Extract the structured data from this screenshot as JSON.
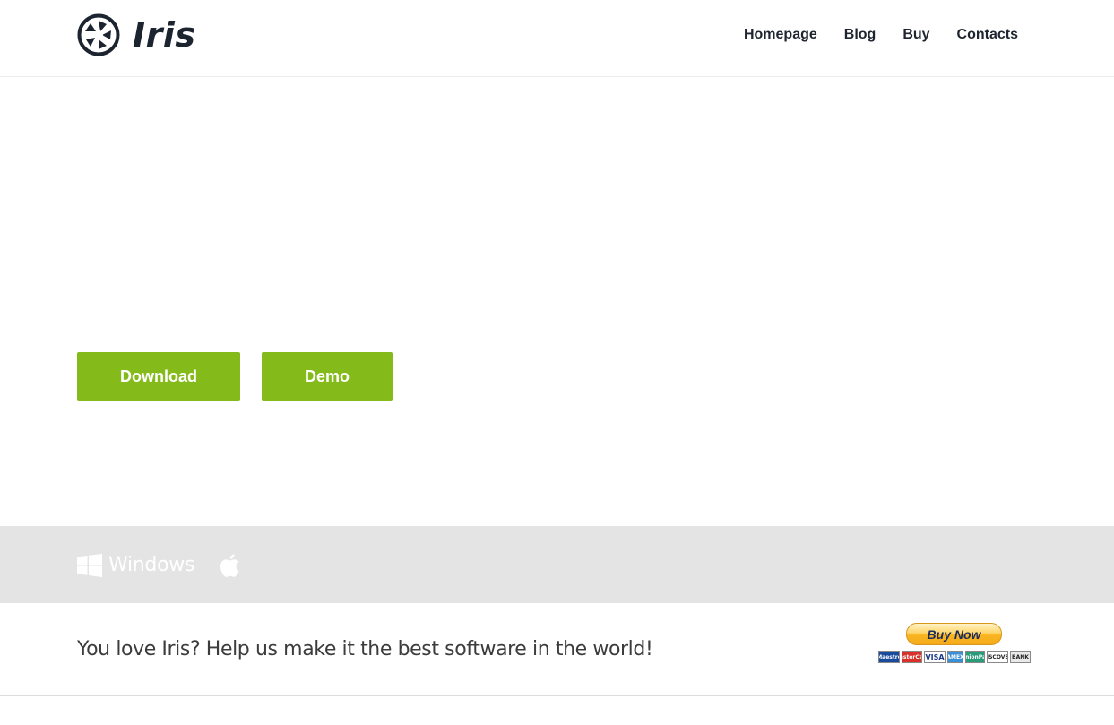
{
  "brand": {
    "name": "Iris"
  },
  "nav": {
    "items": [
      {
        "label": "Homepage"
      },
      {
        "label": "Blog"
      },
      {
        "label": "Buy"
      },
      {
        "label": "Contacts"
      }
    ]
  },
  "hero": {
    "download_label": "Download",
    "demo_label": "Demo"
  },
  "platforms": {
    "windows_label": "Windows",
    "windows_icon": "windows-icon",
    "mac_icon": "apple-icon"
  },
  "support": {
    "text": "You love Iris? Help us make it the best software in the world!",
    "paypal_label": "Buy Now",
    "cards": [
      {
        "name": "Maestro"
      },
      {
        "name": "MasterCard"
      },
      {
        "name": "VISA"
      },
      {
        "name": "AMEX"
      },
      {
        "name": "UnionPay"
      },
      {
        "name": "DISCOVER"
      },
      {
        "name": "BANK"
      }
    ]
  },
  "colors": {
    "accent": "#84bb1a",
    "text_dark": "#1e2530",
    "band": "#e4e4e4"
  }
}
